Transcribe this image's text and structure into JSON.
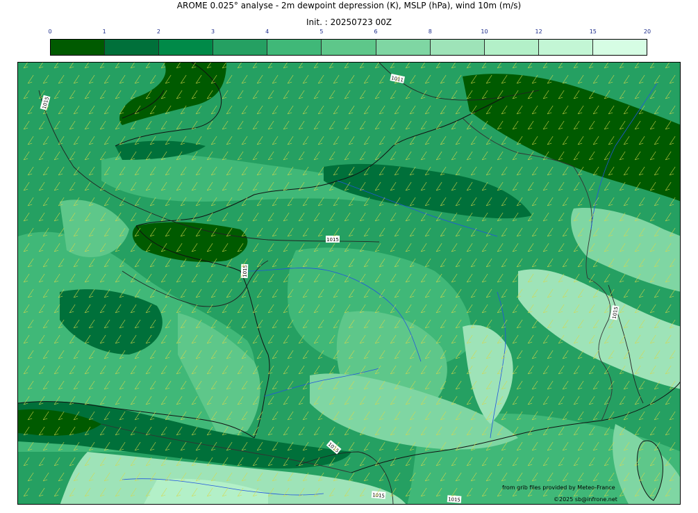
{
  "header": {
    "title": "AROME 0.025° analyse - 2m dewpoint depression (K), MSLP (hPa), wind 10m (m/s)",
    "init": "Init. : 20250723 00Z"
  },
  "colorbar": {
    "ticks": [
      "0",
      "1",
      "2",
      "3",
      "4",
      "5",
      "6",
      "8",
      "10",
      "12",
      "15",
      "20"
    ],
    "colors": [
      "#005a00",
      "#00703a",
      "#008a48",
      "#25a062",
      "#40b878",
      "#5ec78a",
      "#7fd6a3",
      "#9ee3b8",
      "#b3f0c8",
      "#c3f6d5",
      "#d6fde4"
    ]
  },
  "map": {
    "isobar_labels": [
      "1015",
      "1011",
      "1015",
      "1015",
      "1015",
      "1015",
      "1015",
      "1015"
    ],
    "credit_source": "from grib files provided by Meteo-France",
    "credit_author": "©2025 sb@infrone.net",
    "colors": {
      "coast": "#111111",
      "river": "#2255dd",
      "border": "#333333",
      "wind_barb": "#d8d84a"
    }
  }
}
